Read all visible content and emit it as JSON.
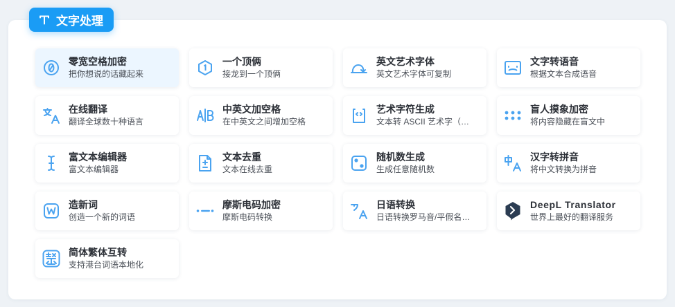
{
  "section": {
    "title": "文字处理",
    "icon": "text-t-icon",
    "accent": "#1a9cf5"
  },
  "tools": [
    {
      "title": "零宽空格加密",
      "desc": "把你想说的话藏起来",
      "icon": "zero-width-icon",
      "active": true
    },
    {
      "title": "一个顶俩",
      "desc": "接龙到一个顶俩",
      "icon": "hexagon-one-icon"
    },
    {
      "title": "英文艺术字体",
      "desc": "英文艺术字体可复制",
      "icon": "curved-arrow-icon"
    },
    {
      "title": "文字转语音",
      "desc": "根据文本合成语音",
      "icon": "speech-box-icon"
    },
    {
      "title": "在线翻译",
      "desc": "翻译全球数十种语言",
      "icon": "translate-icon"
    },
    {
      "title": "中英文加空格",
      "desc": "在中英文之间增加空格",
      "icon": "ab-divider-icon"
    },
    {
      "title": "艺术字符生成",
      "desc": "文本转 ASCII 艺术字（…",
      "icon": "code-file-icon"
    },
    {
      "title": "盲人摸象加密",
      "desc": "将内容隐藏在盲文中",
      "icon": "braille-dots-icon"
    },
    {
      "title": "富文本编辑器",
      "desc": "富文本编辑器",
      "icon": "text-cursor-icon"
    },
    {
      "title": "文本去重",
      "desc": "文本在线去重",
      "icon": "file-diff-icon"
    },
    {
      "title": "随机数生成",
      "desc": "生成任意随机数",
      "icon": "dice-icon"
    },
    {
      "title": "汉字转拼音",
      "desc": "将中文转换为拼音",
      "icon": "chinese-to-a-icon"
    },
    {
      "title": "造新词",
      "desc": "创造一个新的词语",
      "icon": "w-badge-icon"
    },
    {
      "title": "摩斯电码加密",
      "desc": "摩斯电码转换",
      "icon": "morse-code-icon"
    },
    {
      "title": "日语转换",
      "desc": "日语转换罗马音/平假名…",
      "icon": "japanese-a-icon"
    },
    {
      "title": "DeepL Translator",
      "desc": "世界上最好的翻译服务",
      "icon": "deepl-logo-icon"
    },
    {
      "title": "简体繁体互转",
      "desc": "支持港台词语本地化",
      "icon": "traditional-char-icon"
    }
  ]
}
